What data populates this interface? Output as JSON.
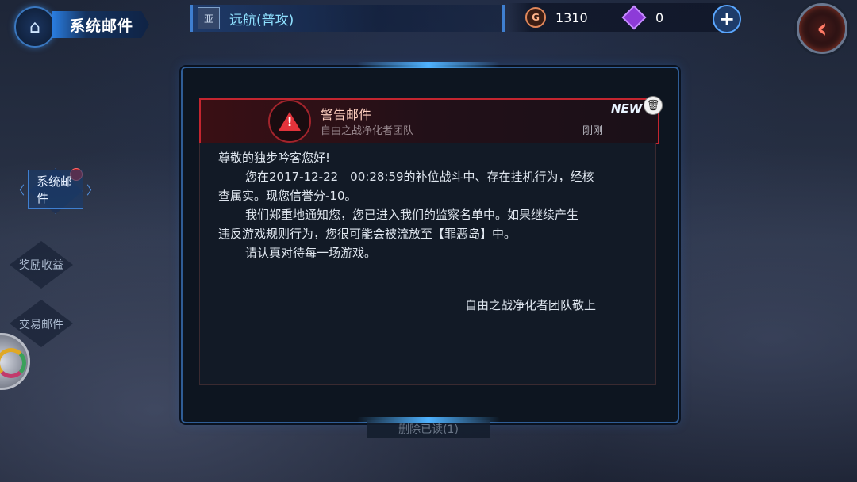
{
  "top_bar": {
    "title": "系统邮件",
    "mode_label": "远航(普攻)",
    "mode_icon_glyph": "亚",
    "gold_symbol": "G",
    "gold_amount": "1310",
    "gem_amount": "0"
  },
  "icons": {
    "home": "⌂",
    "plus": "+",
    "back": "‹",
    "trash": "🗑",
    "warning": "!"
  },
  "sidebar": {
    "items": [
      {
        "label": "系统邮件",
        "active": true
      },
      {
        "label": "奖励收益",
        "active": false
      },
      {
        "label": "交易邮件",
        "active": false
      }
    ]
  },
  "mail": {
    "title": "警告邮件",
    "sender": "自由之战净化者团队",
    "time": "刚刚",
    "badge": "NEW",
    "greeting": "尊敬的独步吟客您好!",
    "line1": "您在2017-12-22　00:28:59的补位战斗中、存在挂机行为，经核",
    "line2": "查属实。现您信誉分-10。",
    "line3": "我们郑重地通知您，您已进入我们的监察名单中。如果继续产生",
    "line4": "违反游戏规则行为，您很可能会被流放至【罪恶岛】中。",
    "line5": "请认真对待每一场游戏。",
    "signature": "自由之战净化者团队敬上"
  },
  "footer": {
    "delete_read": "删除已读(1)"
  },
  "colors": {
    "accent_blue": "#3f7fd0",
    "warning_red": "#c4252f",
    "panel_bg": "#0d1520"
  }
}
